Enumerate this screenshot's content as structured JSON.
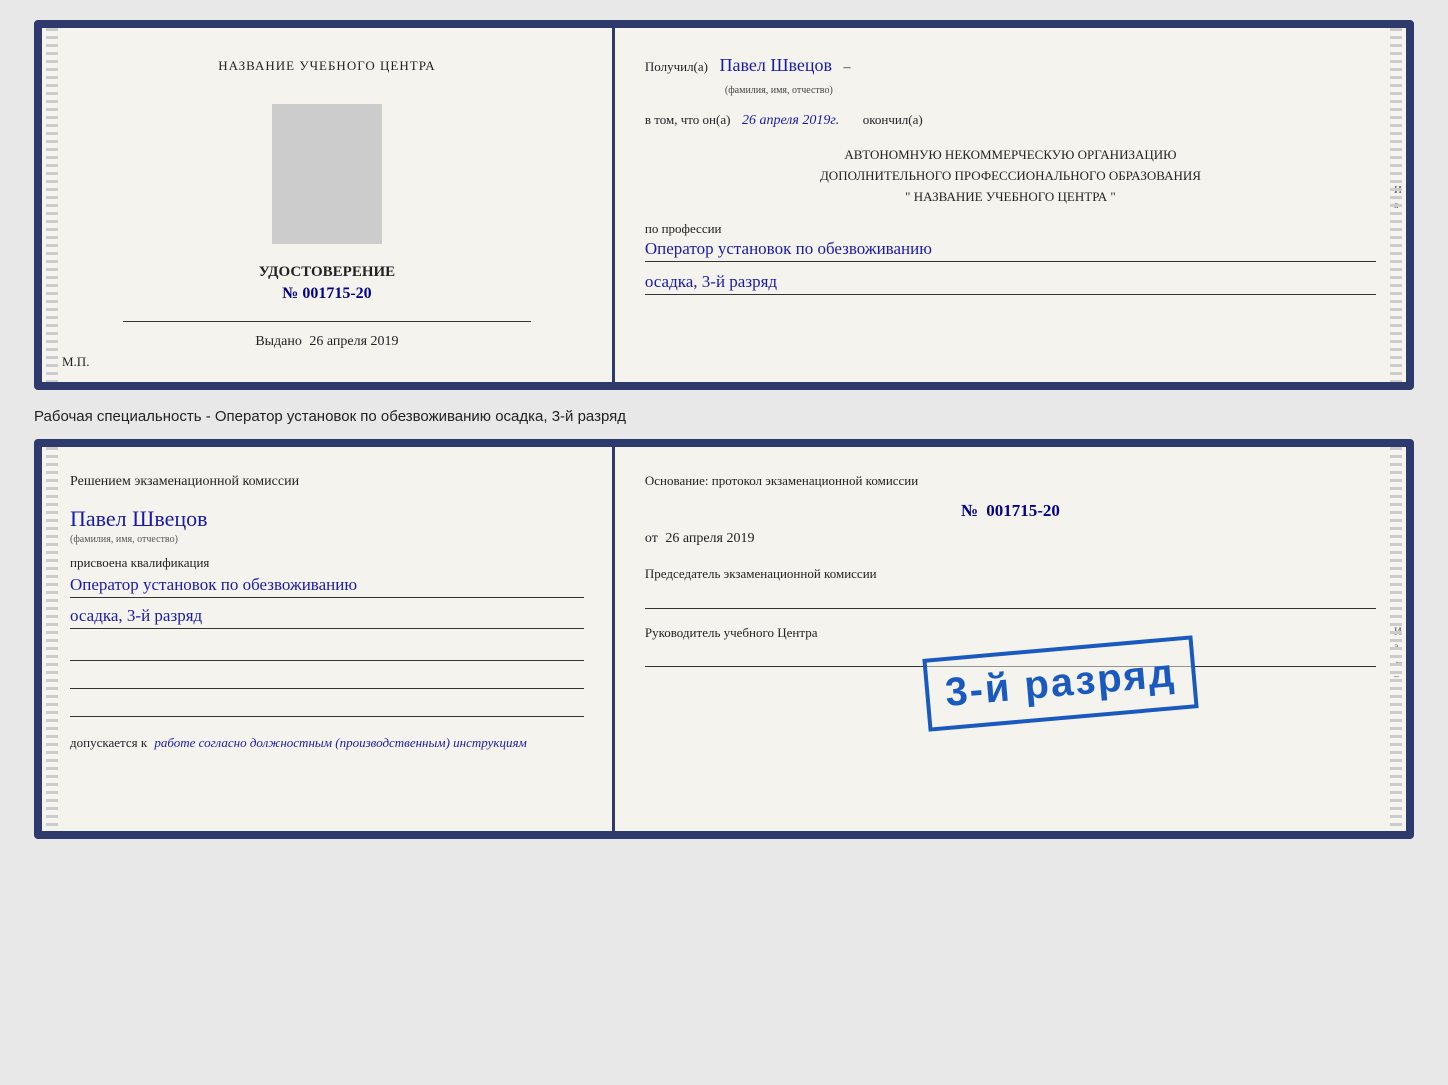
{
  "cert_doc": {
    "left": {
      "top_title": "НАЗВАНИЕ УЧЕБНОГО ЦЕНТРА",
      "doc_title": "УДОСТОВЕРЕНИЕ",
      "doc_number_prefix": "№",
      "doc_number": "001715-20",
      "vydano_label": "Выдано",
      "vydano_date": "26 апреля 2019",
      "mp_label": "М.П."
    },
    "right": {
      "poluchil_label": "Получил(а)",
      "poluchil_name": "Павел Швецов",
      "fio_subtitle": "(фамилия, имя, отчество)",
      "dash": "–",
      "vtom_label": "в том, что он(а)",
      "vtom_date": "26 апреля 2019г.",
      "okonchil_label": "окончил(а)",
      "org_line1": "АВТОНОМНУЮ НЕКОММЕРЧЕСКУЮ ОРГАНИЗАЦИЮ",
      "org_line2": "ДОПОЛНИТЕЛЬНОГО ПРОФЕССИОНАЛЬНОГО ОБРАЗОВАНИЯ",
      "org_line3": "\"    НАЗВАНИЕ УЧЕБНОГО ЦЕНТРА    \"",
      "po_professii_label": "по профессии",
      "profession_line1": "Оператор установок по обезвоживанию",
      "profession_line2": "осадка, 3-й разряд"
    }
  },
  "specialty_text": "Рабочая специальность - Оператор установок по обезвоживанию осадка, 3-й разряд",
  "proto_doc": {
    "left": {
      "heading": "Решением экзаменационной комиссии",
      "name": "Павел Швецов",
      "name_subtitle": "(фамилия, имя, отчество)",
      "kvali_label": "присвоена квалификация",
      "kvali_line1": "Оператор установок по обезвоживанию",
      "kvali_line2": "осадка, 3-й разряд",
      "dopusk_label": "допускается к",
      "dopusk_text": "работе согласно должностным (производственным) инструкциям"
    },
    "right": {
      "osnov_label": "Основание: протокол экзаменационной комиссии",
      "number_prefix": "№",
      "number": "001715-20",
      "ot_label": "от",
      "ot_date": "26 апреля 2019",
      "chairman_label": "Председатель экзаменационной комиссии",
      "ruk_label": "Руководитель учебного Центра"
    },
    "stamp": {
      "text": "3-й разряд"
    }
  }
}
